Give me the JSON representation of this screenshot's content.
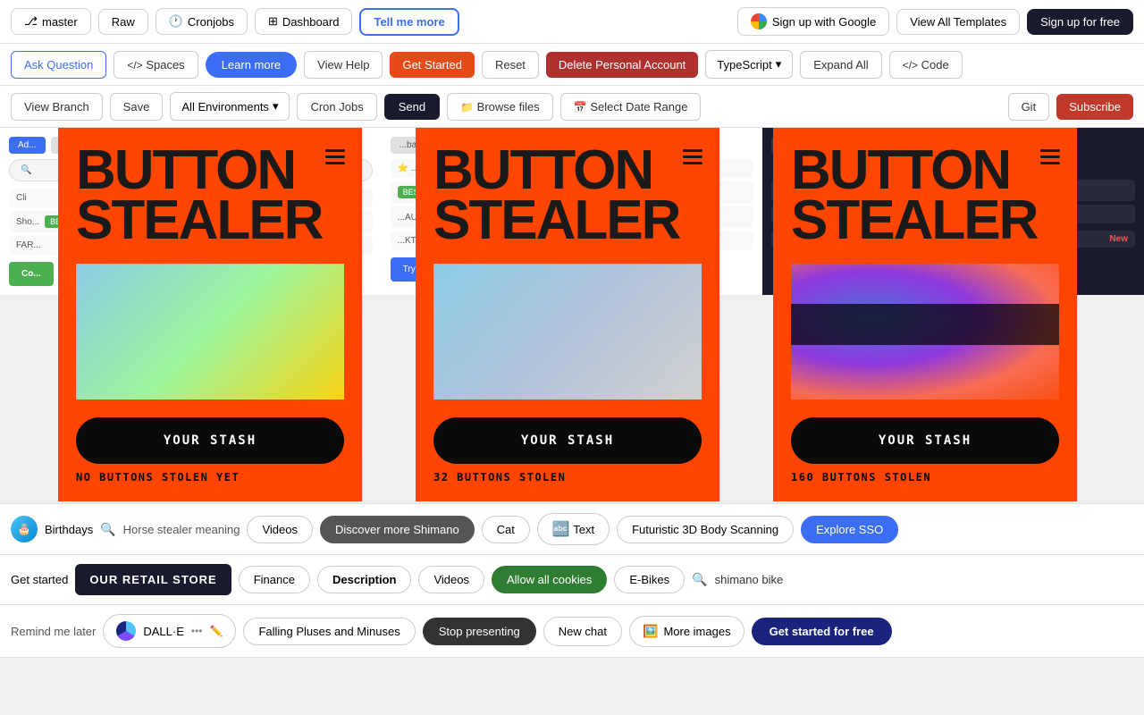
{
  "topbar": {
    "master_label": "master",
    "raw_label": "Raw",
    "cronjobs_label": "Cronjobs",
    "dashboard_label": "Dashboard",
    "tell_me_more_label": "Tell me more",
    "sign_up_google_label": "Sign up with Google",
    "view_all_templates_label": "View All Templates",
    "sign_up_free_label": "Sign up for free"
  },
  "secondbar": {
    "ask_question_label": "Ask Question",
    "spaces_label": "Spaces",
    "learn_more_label": "Learn more",
    "view_help_label": "View Help",
    "get_started_label": "Get Started",
    "reset_label": "Reset",
    "delete_account_label": "Delete Personal Account",
    "typescript_label": "TypeScript",
    "expand_all_label": "Expand All",
    "code_label": "Code"
  },
  "thirdbar": {
    "view_branch_label": "View Branch",
    "save_label": "Save",
    "all_environments_label": "All Environments",
    "cron_jobs_label": "Cron Jobs",
    "send_label": "Send",
    "browse_files_label": "Browse files",
    "select_date_range_label": "Select Date Range",
    "git_label": "Git",
    "subscribe_label": "Subscribe"
  },
  "cards": [
    {
      "title": "BUTTON STEALER",
      "your_stash_label": "YOUR STASH",
      "buttons_stolen_label": "NO BUTTONS STOLEN YET",
      "image_type": "gradient1"
    },
    {
      "title": "BUTTON STEALER",
      "your_stash_label": "YOUR STASH",
      "buttons_stolen_label": "32 BUTTONS STOLEN",
      "image_type": "gradient2"
    },
    {
      "title": "BUTTON STEALER",
      "your_stash_label": "YOUR STASH",
      "buttons_stolen_label": "160 BUTTONS STOLEN",
      "image_type": "gradient3"
    }
  ],
  "bottombar1": {
    "birthdays_label": "Birthdays",
    "search_placeholder": "Horse stealer meaning",
    "videos_label": "Videos",
    "discover_shimano_label": "Discover more Shimano",
    "cat_label": "Cat",
    "text_label": "Text",
    "futuristic_label": "Futuristic 3D Body Scanning",
    "explore_sso_label": "Explore SSO"
  },
  "bottombar2": {
    "get_started_label": "Get started",
    "retail_store_label": "OUR RETAIL STORE",
    "finance_label": "Finance",
    "description_label": "Description",
    "videos_label": "Videos",
    "allow_cookies_label": "Allow all cookies",
    "ebikes_label": "E-Bikes",
    "shimano_bike_label": "shimano bike"
  },
  "bottombar3": {
    "remind_later_label": "Remind me later",
    "dall_e_label": "DALL·E",
    "falling_pluses_label": "Falling Pluses and Minuses",
    "stop_presenting_label": "Stop presenting",
    "new_chat_label": "New chat",
    "more_images_label": "More images",
    "get_started_free_label": "Get started for free"
  }
}
